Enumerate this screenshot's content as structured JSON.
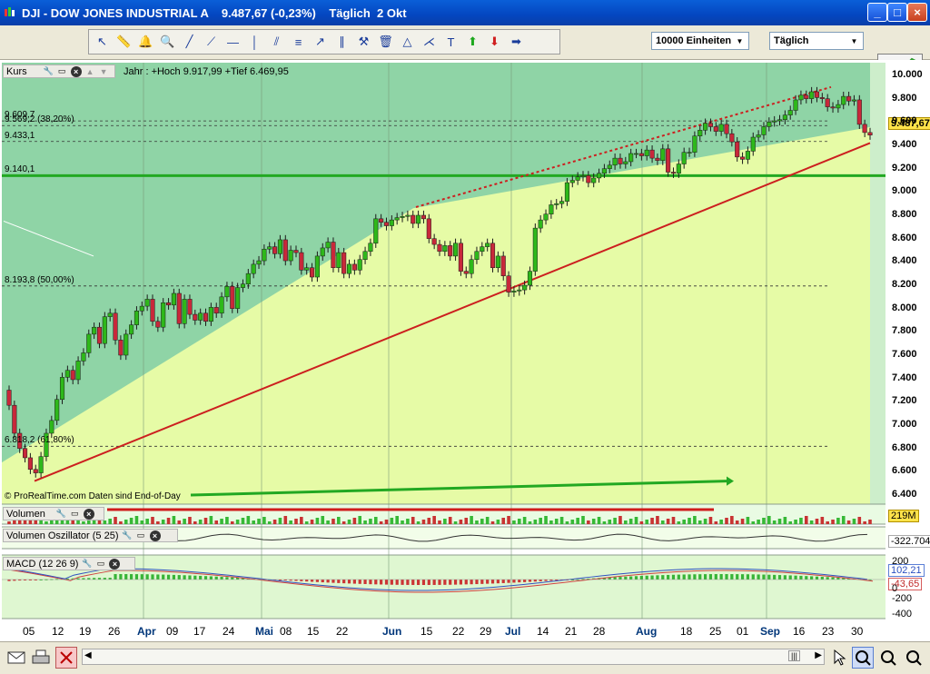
{
  "window": {
    "title": "DJI - DOW JONES INDUSTRIAL A    9.487,67 (-0,23%)    Täglich  2 Okt",
    "buttons": {
      "minimize": "_",
      "maximize": "□",
      "close": "×"
    }
  },
  "toolbar": {
    "tools": [
      "cursor-icon",
      "ruler-icon",
      "alarm-icon",
      "zoom-icon",
      "line-icon",
      "trendline-icon",
      "horizontal-line-icon",
      "vertical-line-icon",
      "channel-icon",
      "fibonacci-icon",
      "arrow-line-icon",
      "parallel-icon",
      "tools-icon",
      "trash-icon",
      "triangle-icon",
      "fan-icon",
      "text-icon",
      "up-arrow-icon",
      "down-arrow-icon",
      "right-arrow-icon"
    ],
    "units_select": "10000 Einheiten",
    "period_select": "Täglich"
  },
  "price_panel": {
    "tag": "Kurs",
    "info": "Jahr : +Hoch 9.917,99 +Tief 6.469,95",
    "copyright": "© ProRealTime.com  Daten sind End-of-Day",
    "fib_labels": [
      {
        "text": "9.609,7",
        "y": 9609.7
      },
      {
        "text": "9.569,2 (38,20%)",
        "y": 9569.2
      },
      {
        "text": "9.433,1",
        "y": 9433.1
      },
      {
        "text": "9.140,1",
        "y": 9140.1
      },
      {
        "text": "8.193,8 (50,00%)",
        "y": 8193.8
      },
      {
        "text": "6.818,2 (61,80%)",
        "y": 6818.2
      }
    ],
    "last_price": "9.487,67",
    "y_ticks": [
      "10.000",
      "9.800",
      "9.600",
      "9.400",
      "9.200",
      "9.000",
      "8.800",
      "8.600",
      "8.400",
      "8.200",
      "8.000",
      "7.800",
      "7.600",
      "7.400",
      "7.200",
      "7.000",
      "6.800",
      "6.600",
      "6.400"
    ]
  },
  "volume_panel": {
    "tag": "Volumen",
    "value": "219M"
  },
  "vol_osc_panel": {
    "tag": "Volumen Oszillator (5 25)",
    "value": "-322.704"
  },
  "macd_panel": {
    "tag": "MACD (12 26 9)",
    "values": [
      "102,21",
      "-43,65"
    ],
    "y_ticks": [
      "200",
      "0",
      "-200",
      "-400"
    ]
  },
  "x_axis": {
    "labels": [
      {
        "text": "05",
        "month": false
      },
      {
        "text": "12",
        "month": false
      },
      {
        "text": "19",
        "month": false
      },
      {
        "text": "26",
        "month": false
      },
      {
        "text": "Apr",
        "month": true
      },
      {
        "text": "09",
        "month": false
      },
      {
        "text": "17",
        "month": false
      },
      {
        "text": "24",
        "month": false
      },
      {
        "text": "Mai",
        "month": true
      },
      {
        "text": "08",
        "month": false
      },
      {
        "text": "15",
        "month": false
      },
      {
        "text": "22",
        "month": false
      },
      {
        "text": "Jun",
        "month": true
      },
      {
        "text": "15",
        "month": false
      },
      {
        "text": "22",
        "month": false
      },
      {
        "text": "29",
        "month": false
      },
      {
        "text": "Jul",
        "month": true
      },
      {
        "text": "14",
        "month": false
      },
      {
        "text": "21",
        "month": false
      },
      {
        "text": "28",
        "month": false
      },
      {
        "text": "Aug",
        "month": true
      },
      {
        "text": "18",
        "month": false
      },
      {
        "text": "25",
        "month": false
      },
      {
        "text": "01",
        "month": false
      },
      {
        "text": "Sep",
        "month": true
      },
      {
        "text": "16",
        "month": false
      },
      {
        "text": "23",
        "month": false
      },
      {
        "text": "30",
        "month": false
      }
    ]
  },
  "colors": {
    "dark_zone": "#8fd4a6",
    "light_zone": "#e6fba6",
    "up_candle": "#2eb81a",
    "down_candle": "#c8283a",
    "trend_line": "#cc1f1f",
    "support_line": "#22a822"
  },
  "chart_data": {
    "type": "candlestick",
    "title": "DJI - DOW JONES INDUSTRIAL A",
    "ylim": [
      6400,
      10000
    ],
    "closes": [
      7170,
      6930,
      6800,
      6720,
      6620,
      6590,
      6730,
      6930,
      7040,
      7220,
      7410,
      7470,
      7390,
      7550,
      7620,
      7780,
      7840,
      7700,
      7930,
      7960,
      7730,
      7600,
      7780,
      7860,
      7980,
      8020,
      8080,
      7890,
      7840,
      8050,
      8030,
      8130,
      7870,
      8080,
      7950,
      7900,
      7960,
      7890,
      8010,
      7960,
      8100,
      8190,
      8000,
      8180,
      8210,
      8300,
      8380,
      8410,
      8510,
      8530,
      8470,
      8590,
      8410,
      8500,
      8480,
      8330,
      8350,
      8270,
      8450,
      8520,
      8570,
      8350,
      8480,
      8300,
      8380,
      8330,
      8420,
      8490,
      8560,
      8770,
      8740,
      8710,
      8760,
      8780,
      8790,
      8800,
      8730,
      8800,
      8770,
      8600,
      8550,
      8490,
      8540,
      8450,
      8560,
      8320,
      8300,
      8420,
      8490,
      8530,
      8560,
      8350,
      8450,
      8280,
      8140,
      8150,
      8160,
      8200,
      8320,
      8690,
      8760,
      8810,
      8890,
      8900,
      8920,
      9080,
      9100,
      9130,
      9140,
      9080,
      9120,
      9160,
      9200,
      9230,
      9290,
      9240,
      9260,
      9330,
      9330,
      9310,
      9360,
      9290,
      9270,
      9370,
      9170,
      9160,
      9240,
      9340,
      9340,
      9480,
      9530,
      9590,
      9560,
      9520,
      9580,
      9500,
      9430,
      9300,
      9280,
      9350,
      9470,
      9490,
      9560,
      9600,
      9610,
      9620,
      9660,
      9700,
      9790,
      9830,
      9800,
      9860,
      9810,
      9800,
      9730,
      9720,
      9750,
      9820,
      9780,
      9790,
      9580,
      9510,
      9487.67
    ]
  }
}
